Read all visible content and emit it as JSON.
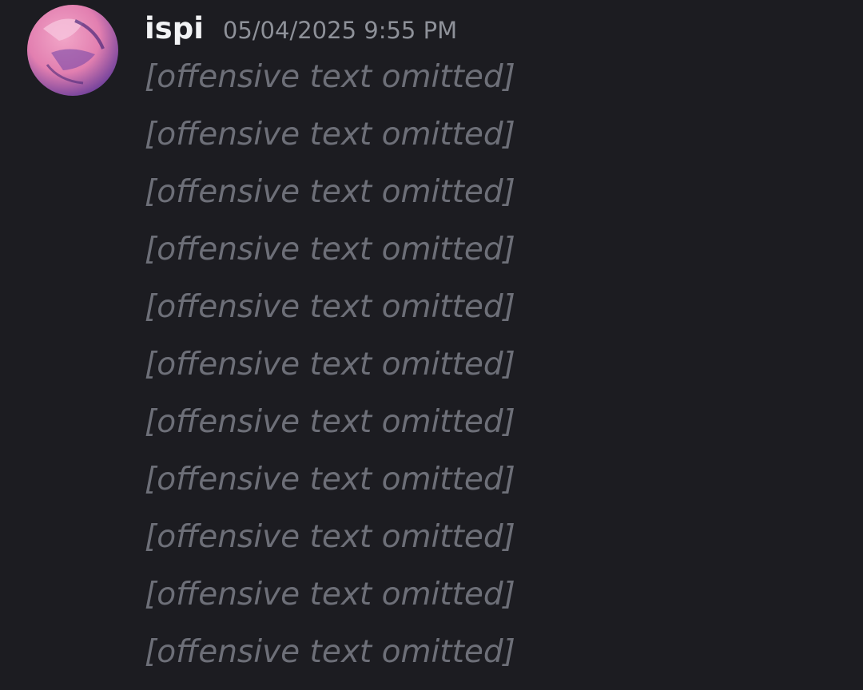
{
  "message": {
    "author": "ispi",
    "timestamp": "05/04/2025 9:55 PM",
    "lines": [
      "[offensive text omitted]",
      "[offensive text omitted]",
      "[offensive text omitted]",
      "[offensive text omitted]",
      "[offensive text omitted]",
      "[offensive text omitted]",
      "[offensive text omitted]",
      "[offensive text omitted]",
      "[offensive text omitted]",
      "[offensive text omitted]",
      "[offensive text omitted]"
    ]
  },
  "colors": {
    "background": "#1c1c21",
    "username": "#f2f3f5",
    "timestamp": "#8e9199"
  }
}
